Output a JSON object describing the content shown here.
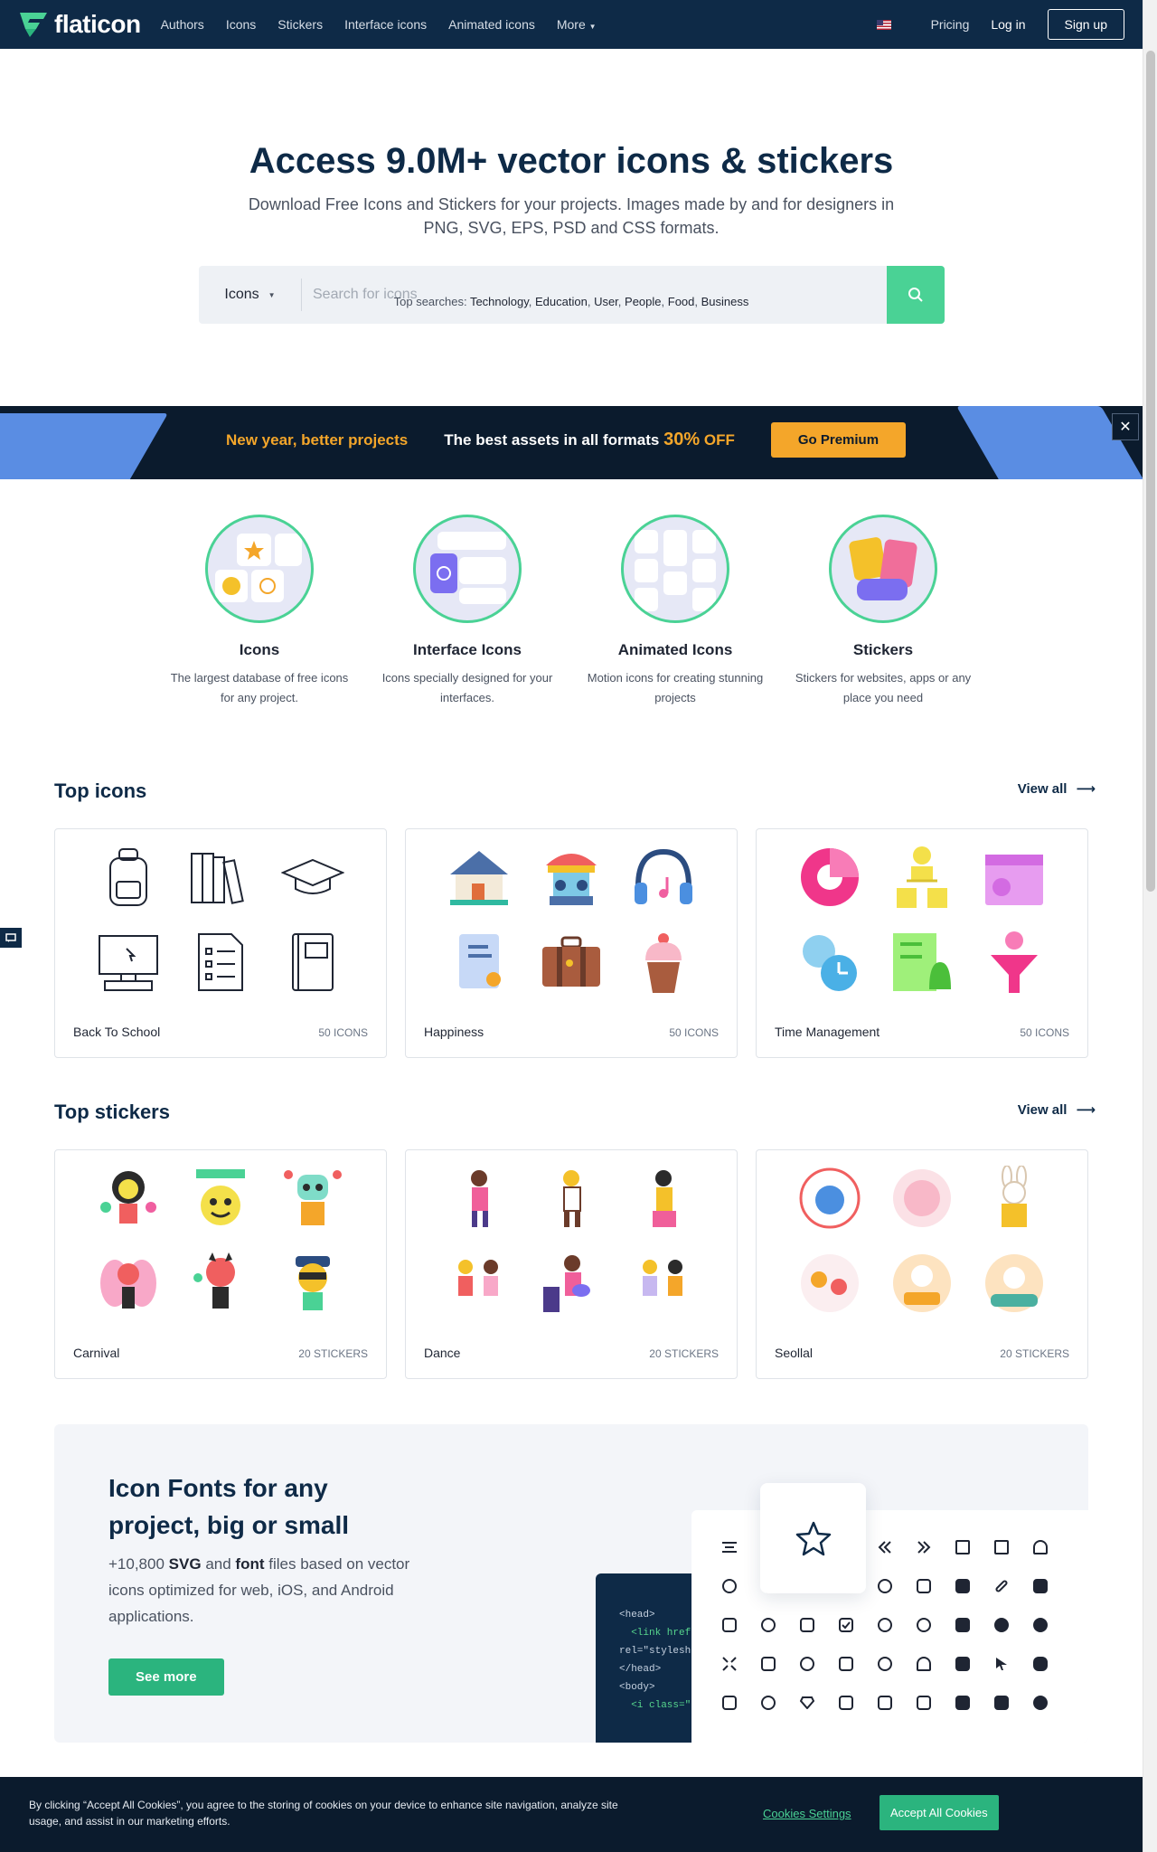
{
  "nav": {
    "brand": "flaticon",
    "links": [
      "Authors",
      "Icons",
      "Stickers",
      "Interface icons",
      "Animated icons",
      "More"
    ],
    "pricing": "Pricing",
    "login": "Log in",
    "signup": "Sign up"
  },
  "hero": {
    "title": "Access 9.0M+ vector icons & stickers",
    "subtitle": "Download Free Icons and Stickers for your projects. Images made by and for designers in PNG, SVG, EPS, PSD and CSS formats.",
    "search_type": "Icons",
    "search_placeholder": "Search for icons",
    "top_searches_label": "Top searches:",
    "top_searches": [
      "Technology",
      "Education",
      "User",
      "People",
      "Food",
      "Business"
    ]
  },
  "banner": {
    "left": "New year, better projects",
    "mid_prefix": "The best assets in all formats",
    "percent": "30%",
    "off": "OFF",
    "cta": "Go Premium",
    "close": "✕"
  },
  "categories": [
    {
      "title": "Icons",
      "desc": "The largest database of free icons for any project."
    },
    {
      "title": "Interface Icons",
      "desc": "Icons specially designed for your interfaces."
    },
    {
      "title": "Animated Icons",
      "desc": "Motion icons for creating stunning projects"
    },
    {
      "title": "Stickers",
      "desc": "Stickers for websites, apps or any place you need"
    }
  ],
  "top_icons": {
    "title": "Top icons",
    "view_all": "View all",
    "packs": [
      {
        "name": "Back To School",
        "count": "50 ICONS"
      },
      {
        "name": "Happiness",
        "count": "50 ICONS"
      },
      {
        "name": "Time Management",
        "count": "50 ICONS"
      }
    ]
  },
  "top_stickers": {
    "title": "Top stickers",
    "view_all": "View all",
    "packs": [
      {
        "name": "Carnival",
        "count": "20 STICKERS"
      },
      {
        "name": "Dance",
        "count": "20 STICKERS"
      },
      {
        "name": "Seollal",
        "count": "20 STICKERS"
      }
    ]
  },
  "icon_fonts": {
    "title": "Icon Fonts for any project, big or small",
    "desc_prefix": "+10,800",
    "svg": "SVG",
    "and": "and",
    "font": "font",
    "desc_suffix": "files based on vector icons optimized for web, iOS, and Android applications.",
    "cta": "See more",
    "code_lines": [
      "<head>",
      "  <link href",
      "rel=\"stylesh",
      "</head>",
      "<body>",
      "  <i class=\""
    ]
  },
  "cookie": {
    "text": "By clicking “Accept All Cookies”, you agree to the storing of cookies on your device to enhance site navigation, analyze site usage, and assist in our marketing efforts.",
    "settings": "Cookies Settings",
    "accept": "Accept All Cookies"
  },
  "colors": {
    "navy": "#0e2a47",
    "green": "#4ad295",
    "orange": "#f4a62a"
  }
}
